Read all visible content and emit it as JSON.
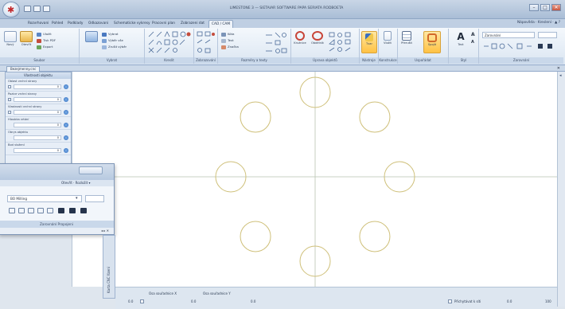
{
  "window": {
    "title": "LIMESTONE 3 — SIETAIAR SOFTWARE PAPA SERIATA RODBOETA",
    "logo_glyph": "✱",
    "controls": {
      "minimize": "–",
      "maximize": "□",
      "close": "✕"
    }
  },
  "tabs": [
    {
      "label": "Rozvrhovani"
    },
    {
      "label": "Pohled"
    },
    {
      "label": "Podklady"
    },
    {
      "label": "Odkazovani"
    },
    {
      "label": "Schematicke vykresy"
    },
    {
      "label": "Pracovni plan"
    },
    {
      "label": "Zobrazeni dat"
    },
    {
      "label": "CAD / CAM"
    }
  ],
  "active_tab_index": 7,
  "help_links": "Nápověda · Kreslení · ▲ ?",
  "ribbon": {
    "groups": [
      {
        "label": "Soubor"
      },
      {
        "label": "Vybrat"
      },
      {
        "label": "Kreslit"
      },
      {
        "label": "Zobrazování"
      },
      {
        "label": "Rozměry a texty"
      },
      {
        "label": "Úprava objektů"
      },
      {
        "label": "Nástroje"
      },
      {
        "label": "Konstrukce"
      },
      {
        "label": "Uspořádat"
      },
      {
        "label": "Styl"
      },
      {
        "label": "Zarovnání"
      }
    ],
    "file_buttons": [
      "Nový",
      "Otevřít",
      "Uložit"
    ],
    "file_small": [
      "Uložit",
      "Tisk PDF",
      "Export"
    ],
    "select_small": [
      "Vybrat",
      "Výběr vše",
      "Zrušit výběr"
    ],
    "dim_small": [
      "Kóta",
      "Text",
      "Značka"
    ],
    "big_labels": [
      "Kružnice",
      "Obdélník",
      "Tvar",
      "Vložit",
      "Přerušit",
      "Spojit",
      "Text"
    ],
    "style_combo": "Zarovnání"
  },
  "document": {
    "tab": "Bezejmenny.cnc",
    "close": "✕"
  },
  "left_panel": {
    "title": "Vlastnosti objektu",
    "rows": [
      {
        "label": "Oblast vrchní strany",
        "value": "0"
      },
      {
        "label": "Pozice vrchní strany",
        "value": "0"
      },
      {
        "label": "Vlastnosti vrchní strany",
        "value": "0"
      },
      {
        "label": "Hloubka vrtání",
        "value": "0"
      },
      {
        "label": "Obrys objektu",
        "value": "0"
      },
      {
        "label": "Bod vložení",
        "value": "0"
      }
    ]
  },
  "floating_window": {
    "quick_label": "Otevřít · Rozložit ▾",
    "combo_value": "BO Milling",
    "group_label": "Zarovnání Propojeni",
    "footer": "◂ ▸ ✕"
  },
  "side_tab": "Karta CNC řízení",
  "statusbar": {
    "x_label": "Osa souřadnice X",
    "y_label": "Osa souřadnice Y",
    "x_value": "0.0",
    "y_value": "0.0",
    "left_value": "0.0",
    "snap_label": "Přichytávat k síti",
    "right_value": "0.0",
    "zoom": "100"
  },
  "canvas": {
    "crosshair_color": "#b9c3b2",
    "circle_color": "#cfc07a",
    "hole_count": 8
  }
}
